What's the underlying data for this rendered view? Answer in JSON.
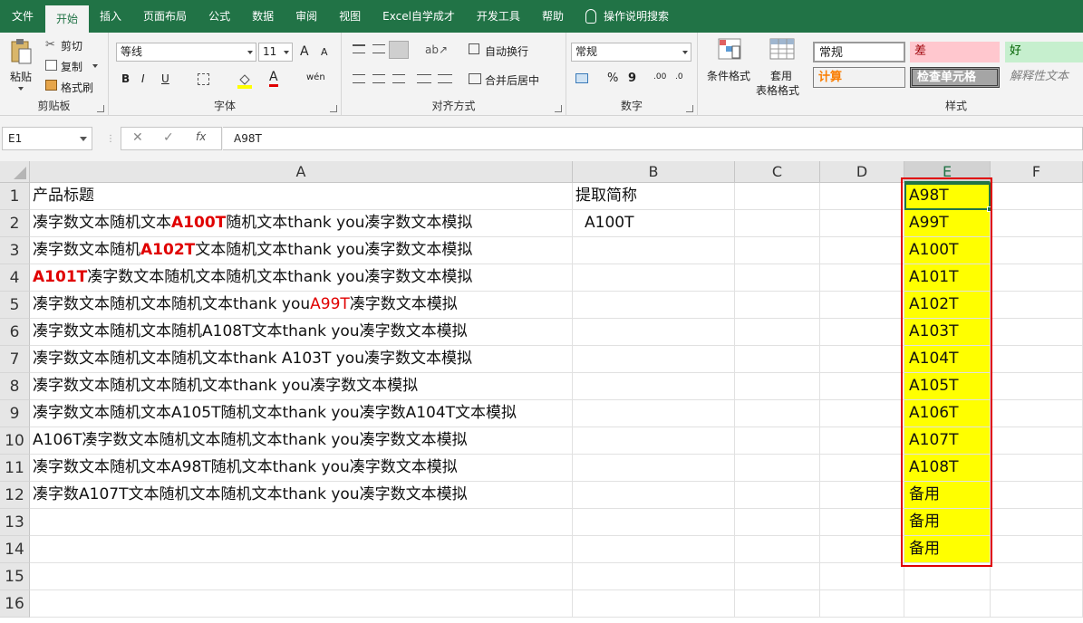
{
  "tabs": [
    "文件",
    "开始",
    "插入",
    "页面布局",
    "公式",
    "数据",
    "审阅",
    "视图",
    "Excel自学成才",
    "开发工具",
    "帮助",
    "操作说明搜索"
  ],
  "active_tab": "开始",
  "ribbon": {
    "clipboard": {
      "paste": "粘贴",
      "cut": "剪切",
      "copy": "复制",
      "format_painter": "格式刷",
      "label": "剪贴板"
    },
    "font": {
      "name": "等线",
      "size": "11",
      "bold": "B",
      "italic": "I",
      "underline": "U",
      "grow": "A",
      "shrink": "A",
      "font_color": "A",
      "phonetic": "wén",
      "label": "字体"
    },
    "alignment": {
      "wrap": "自动换行",
      "merge": "合并后居中",
      "label": "对齐方式"
    },
    "number": {
      "format": "常规",
      "percent": "%",
      "comma": "9",
      "inc_decimal": ".00",
      "dec_decimal": ".0",
      "label": "数字"
    },
    "styles": {
      "conditional": "条件格式",
      "table_line1": "套用",
      "table_line2": "表格格式",
      "cells": [
        "常规",
        "差",
        "好",
        "计算",
        "检查单元格",
        "解释性文本"
      ],
      "label": "样式"
    }
  },
  "formula_bar": {
    "name_box": "E1",
    "cancel": "✕",
    "enter": "✓",
    "fx": "fx",
    "formula": "A98T"
  },
  "columns": [
    "A",
    "B",
    "C",
    "D",
    "E",
    "F"
  ],
  "rows": [
    "1",
    "2",
    "3",
    "4",
    "5",
    "6",
    "7",
    "8",
    "9",
    "10",
    "11",
    "12",
    "13",
    "14",
    "15",
    "16"
  ],
  "colA": [
    [
      {
        "t": "产品标题"
      }
    ],
    [
      {
        "t": "凑字数文本随机文本"
      },
      {
        "t": "A100T",
        "s": "rb"
      },
      {
        "t": "随机文本thank you凑字数文本模拟"
      }
    ],
    [
      {
        "t": "凑字数文本随机"
      },
      {
        "t": "A102T",
        "s": "rb"
      },
      {
        "t": "文本随机文本thank you凑字数文本模拟"
      }
    ],
    [
      {
        "t": "A101T",
        "s": "rb"
      },
      {
        "t": "凑字数文本随机文本随机文本thank you凑字数文本模拟"
      }
    ],
    [
      {
        "t": "凑字数文本随机文本随机文本thank you"
      },
      {
        "t": "A99T",
        "s": "r"
      },
      {
        "t": "凑字数文本模拟"
      }
    ],
    [
      {
        "t": "凑字数文本随机文本随机A108T文本thank you凑字数文本模拟"
      }
    ],
    [
      {
        "t": "凑字数文本随机文本随机文本thank A103T you凑字数文本模拟"
      }
    ],
    [
      {
        "t": "凑字数文本随机文本随机文本thank you凑字数文本模拟"
      }
    ],
    [
      {
        "t": "凑字数文本随机文本A105T随机文本thank you凑字数A104T文本模拟"
      }
    ],
    [
      {
        "t": "A106T凑字数文本随机文本随机文本thank you凑字数文本模拟"
      }
    ],
    [
      {
        "t": "凑字数文本随机文本A98T随机文本thank you凑字数文本模拟"
      }
    ],
    [
      {
        "t": "凑字数A107T文本随机文本随机文本thank you凑字数文本模拟"
      }
    ]
  ],
  "colB": [
    "提取简称",
    "A100T"
  ],
  "colE": [
    "A98T",
    "A99T",
    "A100T",
    "A101T",
    "A102T",
    "A103T",
    "A104T",
    "A105T",
    "A106T",
    "A107T",
    "A108T",
    "备用",
    "备用",
    "备用"
  ],
  "colors": {
    "excel_green": "#217346",
    "highlight_yellow": "#ffff00",
    "red": "#e00000"
  }
}
